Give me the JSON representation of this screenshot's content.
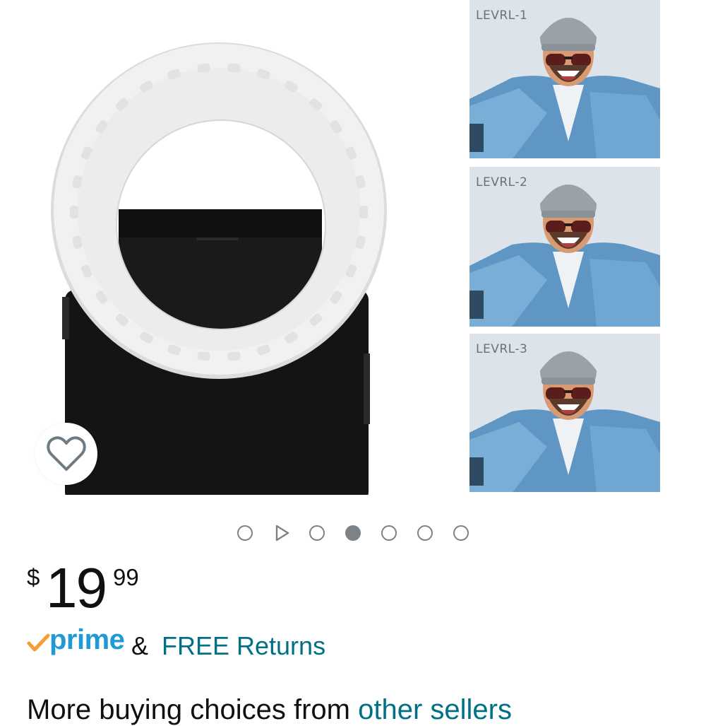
{
  "gallery": {
    "comparison_labels": [
      "LEVRL-1",
      "LEVRL-2",
      "LEVRL-3"
    ],
    "slide_count": 7,
    "active_slide": 4,
    "video_slide": 2
  },
  "price": {
    "currency_symbol": "$",
    "whole": "19",
    "fraction": "99"
  },
  "delivery": {
    "prime_label": "prime",
    "ampersand": "&",
    "returns_label": "FREE Returns"
  },
  "bottom_text": {
    "visible": "More buying choices from ",
    "link_visible": "other sellers"
  },
  "icons": {
    "wishlist": "heart-outline-icon",
    "prime_check": "prime-check-icon",
    "video": "play-icon"
  },
  "colors": {
    "link": "#007185",
    "prime_blue": "#1f9ad5",
    "prime_check": "#f79c34",
    "dot": "#7d8287"
  }
}
